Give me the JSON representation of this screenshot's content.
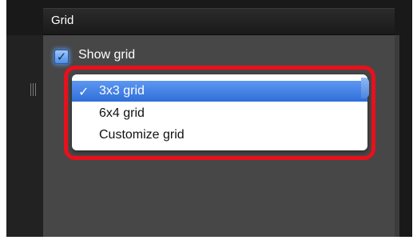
{
  "panel": {
    "title": "Grid"
  },
  "show_grid": {
    "label": "Show grid",
    "checked": true,
    "check_glyph": "✓"
  },
  "grid_dropdown": {
    "items": [
      {
        "label": "3x3 grid",
        "selected": true,
        "check": "✓"
      },
      {
        "label": "6x4 grid",
        "selected": false,
        "check": ""
      },
      {
        "label": "Customize grid",
        "selected": false,
        "check": ""
      }
    ]
  },
  "colors": {
    "highlight": "#e8101c",
    "selection": "#2f6fd8",
    "panel_bg": "#474747"
  }
}
